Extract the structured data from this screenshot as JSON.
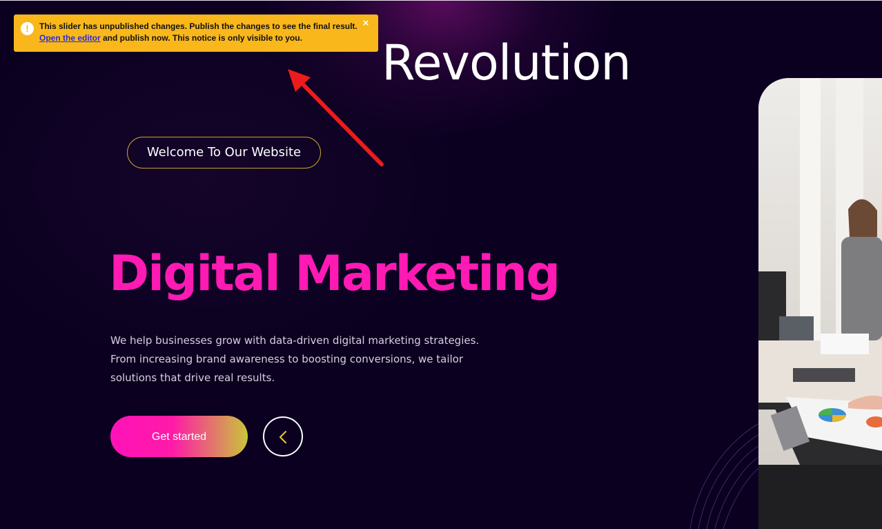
{
  "notice": {
    "line1": "This slider has unpublished changes. Publish the changes to see the final result.",
    "link_text": "Open the editor",
    "line2_rest": " and publish now. This notice is only visible to you.",
    "icon": "exclamation-icon",
    "close_symbol": "×"
  },
  "brand": {
    "title": "Revolution"
  },
  "hero": {
    "welcome": "Welcome To Our Website",
    "headline": "Digital Marketing",
    "description": "We help businesses grow with data-driven digital marketing strategies. From increasing brand awareness to boosting conversions, we tailor solutions that drive real results.",
    "cta_label": "Get started",
    "prev_icon": "chevron-left-icon"
  },
  "colors": {
    "background": "#0b0020",
    "accent_pink": "#ff1ab4",
    "notice_bg": "#f9b71c",
    "pill_border": "#c7a32a",
    "arrow_red": "#ec1c1c"
  }
}
